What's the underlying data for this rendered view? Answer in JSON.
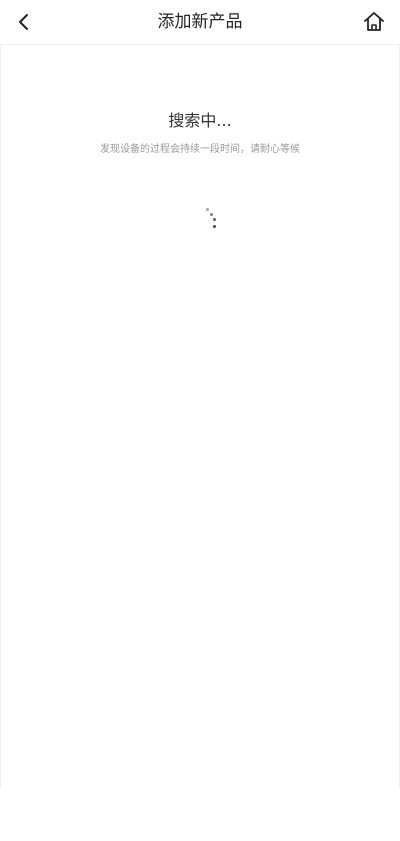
{
  "header": {
    "title": "添加新产品",
    "back_icon": "chevron-left-icon",
    "home_icon": "home-icon"
  },
  "search": {
    "title": "搜索中...",
    "hint": "发现设备的过程会持续一段时间，请耐心等候"
  },
  "colors": {
    "text_primary": "#222222",
    "text_secondary": "#9a9a9a",
    "background": "#ffffff",
    "spinner": "#555555"
  }
}
